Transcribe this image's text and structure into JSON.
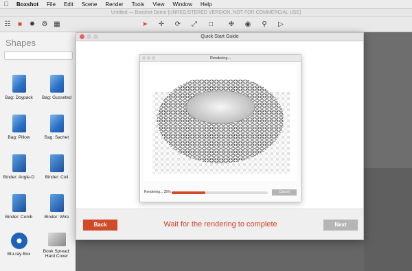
{
  "menubar": {
    "app": "Boxshot",
    "items": [
      "File",
      "Edit",
      "Scene",
      "Render",
      "Tools",
      "View",
      "Window",
      "Help"
    ]
  },
  "window": {
    "title": "Untitled — Boxshot Demo [UNREGISTERED VERSION, NOT FOR COMMERCIAL USE]"
  },
  "sidebar": {
    "title": "Shapes",
    "items": [
      {
        "label": "Bag: Doypack"
      },
      {
        "label": "Bag: Gusseted"
      },
      {
        "label": "Bag: Pillow"
      },
      {
        "label": "Bag: Sachet"
      },
      {
        "label": "Binder: Angle-D"
      },
      {
        "label": "Binder: Coil"
      },
      {
        "label": "Binder: Comb"
      },
      {
        "label": "Binder: Wire"
      },
      {
        "label": "Blu-ray Box"
      },
      {
        "label": "Book Spread: Hard Cover"
      }
    ]
  },
  "dialog": {
    "title": "Quick Start Guide",
    "back_label": "Back",
    "next_label": "Next",
    "instruction": "Wait for the rendering to complete"
  },
  "render_window": {
    "title": "Rendering...",
    "status": "Rendering... 35%",
    "progress": 0.35,
    "cancel_label": "Cancel"
  },
  "colors": {
    "accent": "#d24a2c",
    "disabled": "#b5b5b5"
  }
}
